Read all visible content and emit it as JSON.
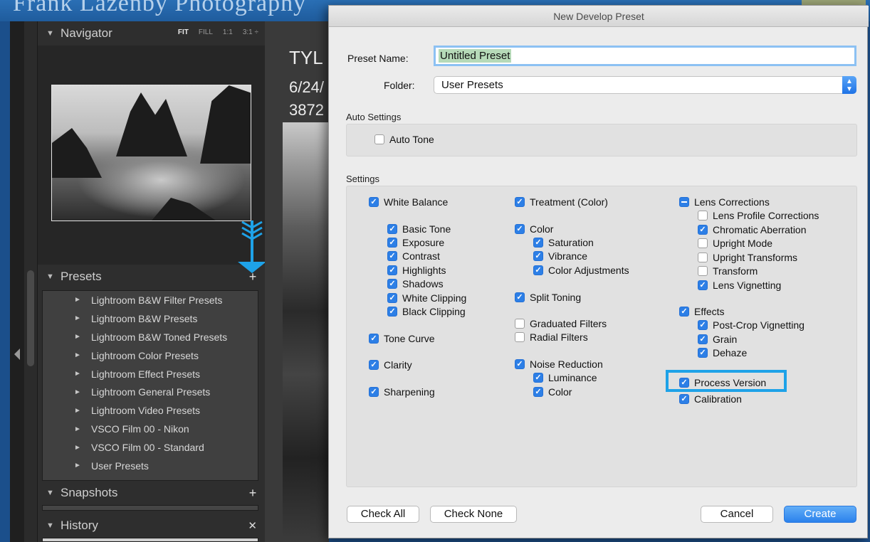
{
  "background": {
    "banner_text": "Frank Lazenby Photography"
  },
  "lightroom": {
    "navigator": {
      "title": "Navigator",
      "zoom": [
        "FIT",
        "FILL",
        "1:1",
        "3:1 ÷"
      ]
    },
    "presets": {
      "title": "Presets",
      "items": [
        "Lightroom B&W Filter Presets",
        "Lightroom B&W Presets",
        "Lightroom B&W Toned Presets",
        "Lightroom Color Presets",
        "Lightroom Effect Presets",
        "Lightroom General Presets",
        "Lightroom Video Presets",
        "VSCO Film 00 - Nikon",
        "VSCO Film 00 - Standard",
        "User Presets"
      ]
    },
    "snapshots": {
      "title": "Snapshots"
    },
    "history": {
      "title": "History"
    },
    "main": {
      "line1": "TYL",
      "line2": "6/24/",
      "line3": "3872"
    }
  },
  "dialog": {
    "title": "New Develop Preset",
    "preset_name_label": "Preset Name:",
    "preset_name_value": "Untitled Preset",
    "folder_label": "Folder:",
    "folder_value": "User Presets",
    "auto_settings_label": "Auto Settings",
    "auto_tone": {
      "label": "Auto Tone",
      "checked": false
    },
    "settings_label": "Settings",
    "col1": [
      {
        "label": "White Balance",
        "state": "on"
      },
      {
        "label": "Basic Tone",
        "state": "on"
      },
      {
        "label": "Exposure",
        "state": "on"
      },
      {
        "label": "Contrast",
        "state": "on"
      },
      {
        "label": "Highlights",
        "state": "on"
      },
      {
        "label": "Shadows",
        "state": "on"
      },
      {
        "label": "White Clipping",
        "state": "on"
      },
      {
        "label": "Black Clipping",
        "state": "on"
      },
      {
        "label": "Tone Curve",
        "state": "on"
      },
      {
        "label": "Clarity",
        "state": "on"
      },
      {
        "label": "Sharpening",
        "state": "on"
      }
    ],
    "col2": [
      {
        "label": "Treatment (Color)",
        "state": "on"
      },
      {
        "label": "Color",
        "state": "on"
      },
      {
        "label": "Saturation",
        "state": "on"
      },
      {
        "label": "Vibrance",
        "state": "on"
      },
      {
        "label": "Color Adjustments",
        "state": "on"
      },
      {
        "label": "Split Toning",
        "state": "on"
      },
      {
        "label": "Graduated Filters",
        "state": "off"
      },
      {
        "label": "Radial Filters",
        "state": "off"
      },
      {
        "label": "Noise Reduction",
        "state": "on"
      },
      {
        "label": "Luminance",
        "state": "on"
      },
      {
        "label": "Color",
        "state": "on"
      }
    ],
    "col3": [
      {
        "label": "Lens Corrections",
        "state": "mixed"
      },
      {
        "label": "Lens Profile Corrections",
        "state": "off"
      },
      {
        "label": "Chromatic Aberration",
        "state": "on"
      },
      {
        "label": "Upright Mode",
        "state": "off"
      },
      {
        "label": "Upright Transforms",
        "state": "off"
      },
      {
        "label": "Transform",
        "state": "off"
      },
      {
        "label": "Lens Vignetting",
        "state": "on"
      },
      {
        "label": "Effects",
        "state": "on"
      },
      {
        "label": "Post-Crop Vignetting",
        "state": "on"
      },
      {
        "label": "Grain",
        "state": "on"
      },
      {
        "label": "Dehaze",
        "state": "on"
      },
      {
        "label": "Process Version",
        "state": "on"
      },
      {
        "label": "Calibration",
        "state": "on"
      }
    ],
    "buttons": {
      "check_all": "Check All",
      "check_none": "Check None",
      "cancel": "Cancel",
      "create": "Create"
    },
    "accent_color": "#2d7fe6",
    "highlight_color": "#1ea2e8"
  }
}
